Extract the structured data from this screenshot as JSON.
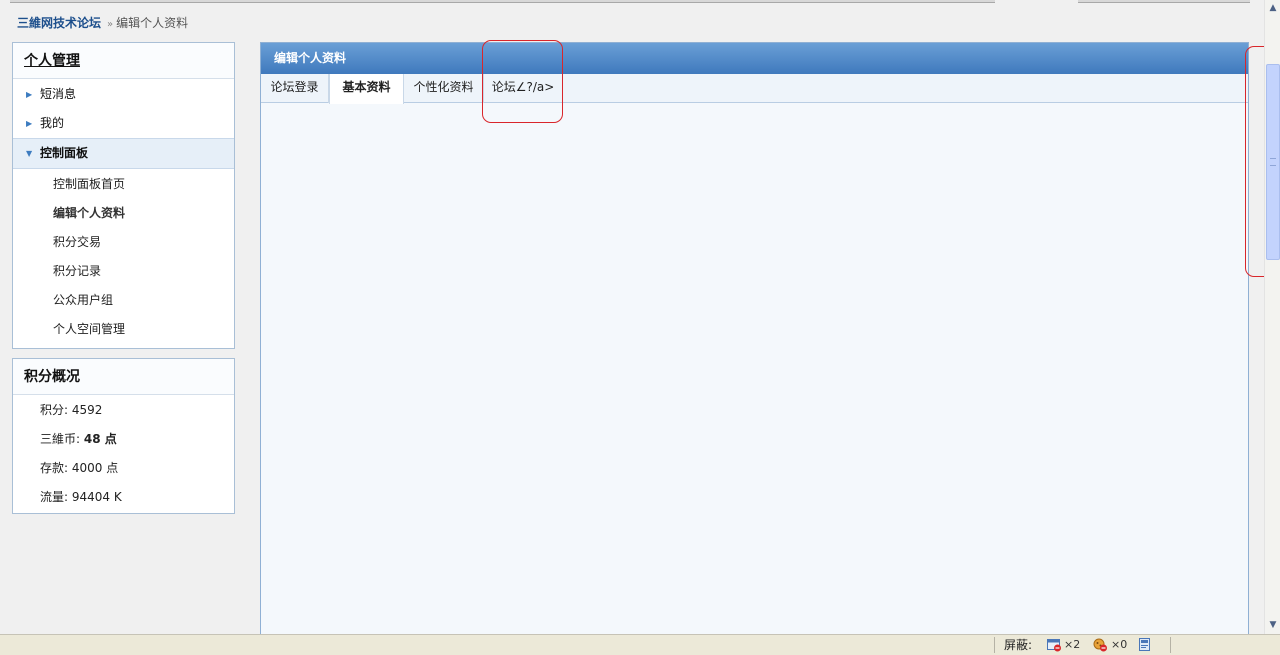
{
  "breadcrumb": {
    "home": "三維网技术论坛",
    "separator": "»",
    "current": "编辑个人资料"
  },
  "sidebar": {
    "title": "个人管理",
    "items": [
      {
        "label": "短消息"
      },
      {
        "label": "我的"
      },
      {
        "label": "控制面板"
      }
    ],
    "sub_items": [
      {
        "label": "控制面板首页"
      },
      {
        "label": "编辑个人资料"
      },
      {
        "label": "积分交易"
      },
      {
        "label": "积分记录"
      },
      {
        "label": "公众用户组"
      },
      {
        "label": "个人空间管理"
      }
    ]
  },
  "score_panel": {
    "title": "积分概况",
    "rows": [
      {
        "label": "积分: ",
        "value": "4592"
      },
      {
        "label": "三維币: ",
        "value": "48 点"
      },
      {
        "label": "存款: ",
        "value": "4000 点"
      },
      {
        "label": "流量: ",
        "value": "94404 K"
      }
    ]
  },
  "main": {
    "header": "编辑个人资料",
    "tabs": [
      {
        "label": "论坛登录"
      },
      {
        "label": "基本资料"
      },
      {
        "label": "个性化资料"
      },
      {
        "label": "论坛∠?/a>"
      }
    ]
  },
  "statusbar": {
    "blocked_label": "屏蔽:",
    "popup_count": "×2",
    "cookie_count": "×0"
  },
  "colors": {
    "header_gradient_top": "#6a9fd6",
    "header_gradient_bottom": "#3f79bd",
    "annotation_red": "#d9262b",
    "link_blue": "#1d4f8c"
  }
}
